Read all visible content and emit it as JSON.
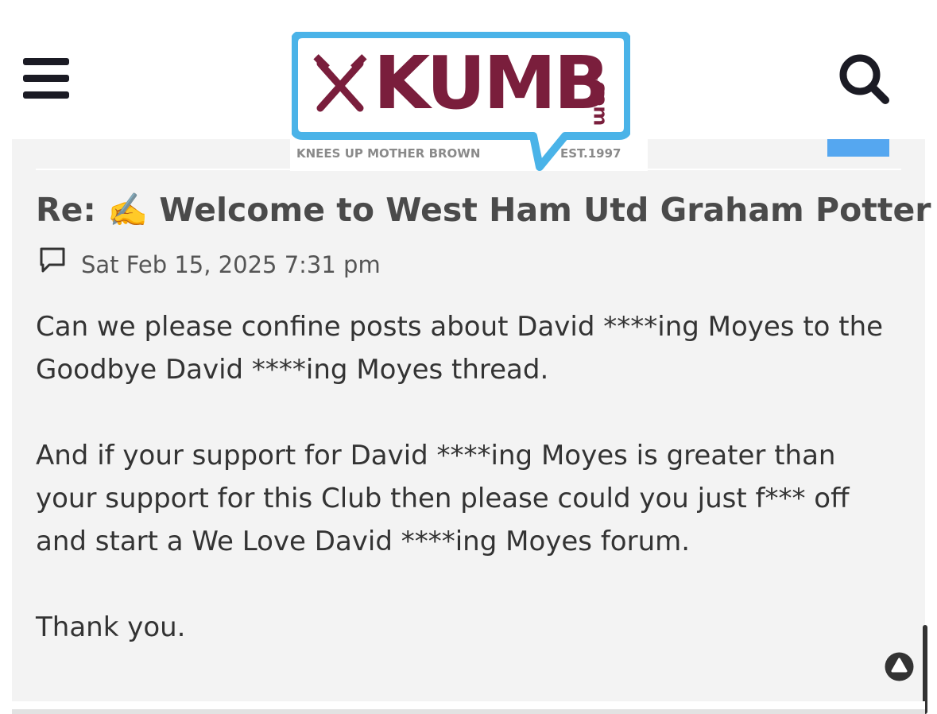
{
  "header": {
    "menu_icon": "hamburger-menu-icon",
    "search_icon": "search-icon",
    "logo": {
      "text": "KUMB",
      "suffix": ".com",
      "tagline": "KNEES UP MOTHER BROWN",
      "established": "EST.1997",
      "bubble_color": "#4ab3e8",
      "text_color": "#7a1e3c"
    }
  },
  "post": {
    "title": "Re: ✍️ Welcome to West Ham Utd Graham Potter",
    "post_icon": "speech-bubble-icon",
    "date": "Sat Feb 15, 2025 7:31 pm",
    "paragraphs": [
      "Can we please confine posts about David ****ing Moyes to the Goodbye David ****ing Moyes thread.",
      "And if your support for David ****ing Moyes is greater than your support for this Club then please could you just f*** off and start a We Love David ****ing Moyes forum.",
      "Thank you."
    ]
  },
  "controls": {
    "back_to_top_icon": "arrow-up-circle-icon"
  },
  "colors": {
    "accent_blue": "#55a7f0",
    "card_background": "#f3f3f3",
    "title_color": "#4a4a4a"
  }
}
